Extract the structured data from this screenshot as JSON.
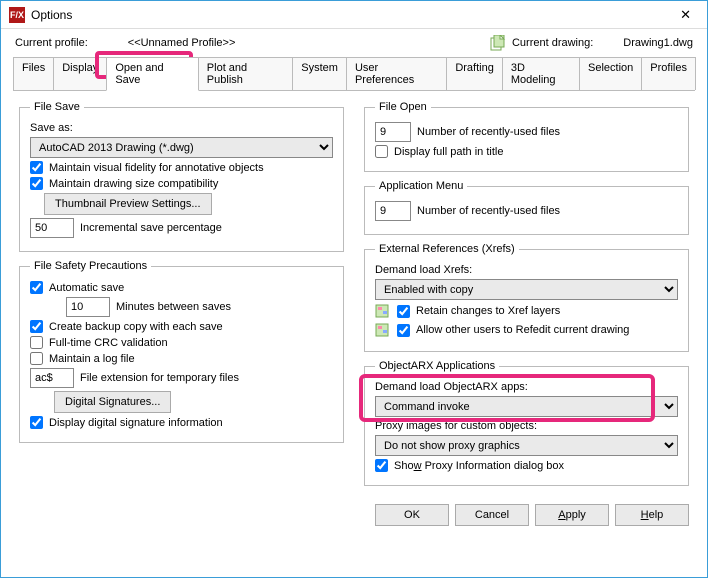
{
  "window": {
    "title": "Options",
    "fx": "F/X"
  },
  "profile": {
    "label": "Current profile:",
    "name": "<<Unnamed Profile>>",
    "drawing_label": "Current drawing:",
    "drawing_name": "Drawing1.dwg"
  },
  "tabs": [
    "Files",
    "Display",
    "Open and Save",
    "Plot and Publish",
    "System",
    "User Preferences",
    "Drafting",
    "3D Modeling",
    "Selection",
    "Profiles"
  ],
  "active_tab": 2,
  "file_save": {
    "legend": "File Save",
    "save_as_label": "Save as:",
    "format": "AutoCAD 2013 Drawing (*.dwg)",
    "fidelity": "Maintain visual fidelity for annotative objects",
    "compat": "Maintain drawing size compatibility",
    "thumbnail_btn": "Thumbnail Preview Settings...",
    "save_pct": "50",
    "save_pct_label": "Incremental save percentage"
  },
  "safety": {
    "legend": "File Safety Precautions",
    "auto_save": "Automatic save",
    "minutes": "10",
    "minutes_label": "Minutes between saves",
    "backup": "Create backup copy with each save",
    "crc": "Full-time CRC validation",
    "log": "Maintain a log file",
    "ext": "ac$",
    "ext_label": "File extension for temporary files",
    "sig_btn": "Digital Signatures...",
    "sig_info": "Display digital signature information"
  },
  "file_open": {
    "legend": "File Open",
    "recent": "9",
    "recent_label": "Number of recently-used files",
    "fullpath": "Display full path in title"
  },
  "app_menu": {
    "legend": "Application Menu",
    "recent": "9",
    "recent_label": "Number of recently-used files"
  },
  "xrefs": {
    "legend": "External References (Xrefs)",
    "demand_label": "Demand load Xrefs:",
    "demand_value": "Enabled with copy",
    "retain": "Retain changes to Xref layers",
    "allow": "Allow other users to Refedit current drawing"
  },
  "arx": {
    "legend": "ObjectARX Applications",
    "demand_label": "Demand load ObjectARX apps:",
    "demand_value": "Command invoke",
    "proxy_label": "Proxy images for custom objects:",
    "proxy_value": "Do not show proxy graphics",
    "show_proxy": "Show Proxy Information dialog box"
  },
  "buttons": {
    "ok": "OK",
    "cancel": "Cancel",
    "apply": "Apply",
    "help": "Help"
  },
  "highlight": {
    "tab": "Open and Save",
    "section": "Demand load ObjectARX apps"
  }
}
